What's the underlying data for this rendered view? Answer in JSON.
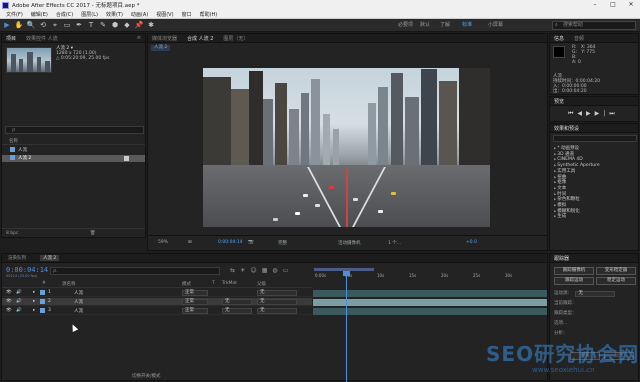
{
  "window": {
    "title": "Adobe After Effects CC 2017 - 无标题项目.aep *",
    "minimize": "–",
    "maximize": "□",
    "close": "✕"
  },
  "menu": [
    "文件(F)",
    "编辑(E)",
    "合成(C)",
    "图层(L)",
    "效果(T)",
    "动画(A)",
    "视图(V)",
    "窗口",
    "帮助(H)"
  ],
  "toolbar": {
    "tools": [
      "▶",
      "✋",
      "🔍",
      "⟲",
      "⌖",
      "▭",
      "✒",
      "T",
      "✎",
      "⬢",
      "◆",
      "📌",
      "✱"
    ],
    "workspaces": [
      "默认",
      "了解",
      "标准",
      "小屏幕"
    ],
    "active_workspace": "标准",
    "extra_ws": "必要项",
    "search_placeholder": "搜索帮助"
  },
  "project": {
    "tabs": [
      "项目",
      "效果控件 人流"
    ],
    "item_name": "人流 2 ▾",
    "item_size": "1280 x 720 (1.00)",
    "item_duration": "△ 0:05:20:09, 25.00 fps",
    "search_placeholder": "ρ",
    "col_name": "名称",
    "items": [
      {
        "name": "人流",
        "selected": false
      },
      {
        "name": "人流 2",
        "selected": true
      }
    ],
    "footer": "8 bpc"
  },
  "viewer": {
    "tabs": [
      "媒体浏览器",
      "合成 人流 2",
      "图层（无）"
    ],
    "active_tab": "合成 人流 2",
    "sub_tab": "人流 2",
    "zoom": "59%",
    "timecode": "0:00:04:14",
    "quality": "完整",
    "camera": "活动摄像机",
    "views": "1 个...",
    "exposure": "+0.0"
  },
  "info": {
    "tabs": [
      "信息",
      "音频"
    ],
    "r": "R:",
    "g": "G:",
    "b": "B:",
    "a": "A: 0",
    "x": "X: 364",
    "y": "Y: 775",
    "layer_name": "人流",
    "layer_duration": "持续时间：0:00:04:20",
    "layer_in": "入：0:00:00:00",
    "layer_out": "出：0:00:04:20"
  },
  "preview": {
    "title": "预览",
    "buttons": [
      "⏮",
      "◀",
      "▶",
      "▶|",
      "⏭"
    ]
  },
  "effects": {
    "title": "效果和预设",
    "list": [
      "* 动画预设",
      "3D 通道",
      "CINEMA 4D",
      "Synthetic Aperture",
      "实用工具",
      "扭曲",
      "抠像",
      "文本",
      "时间",
      "杂色和颗粒",
      "模拟",
      "模糊和锐化",
      "生成"
    ]
  },
  "timeline": {
    "tabs": [
      "渲染队列",
      "人流 2"
    ],
    "active_tab": "人流 2",
    "timecode": "0:00:04:14",
    "timecode_sub": "00114 (25.00 fps)",
    "search_placeholder": "ρ.",
    "col_headers": [
      "#",
      "源名称",
      "模式",
      "T",
      "TrkMat",
      "父级"
    ],
    "layers": [
      {
        "num": "1",
        "name": "人流",
        "mode": "正常",
        "trkmat": "",
        "parent": "无",
        "selected": false
      },
      {
        "num": "2",
        "name": "人流",
        "mode": "正常",
        "trkmat": "无",
        "parent": "无",
        "selected": true
      },
      {
        "num": "3",
        "name": "人流",
        "mode": "正常",
        "trkmat": "无",
        "parent": "无",
        "selected": false
      }
    ],
    "ruler": [
      "0:00s",
      "05s",
      "10s",
      "15s",
      "20s",
      "25s",
      "30s"
    ],
    "footer_left": "切换开关/模式"
  },
  "align": {
    "title": "跟踪器",
    "buttons": [
      "跟踪摄像机",
      "变形稳定器",
      "跟踪运动",
      "稳定运动"
    ],
    "source_label": "运动源：",
    "source_value": "无",
    "current_label": "当前跟踪：",
    "type_label": "跟踪类型：",
    "options": "选项...",
    "analyze": "分析：",
    "reset": "重置",
    "apply": "应用"
  },
  "watermark": {
    "line1": "SEO研究协会网",
    "line2": "www.seoxiehui.cn"
  }
}
